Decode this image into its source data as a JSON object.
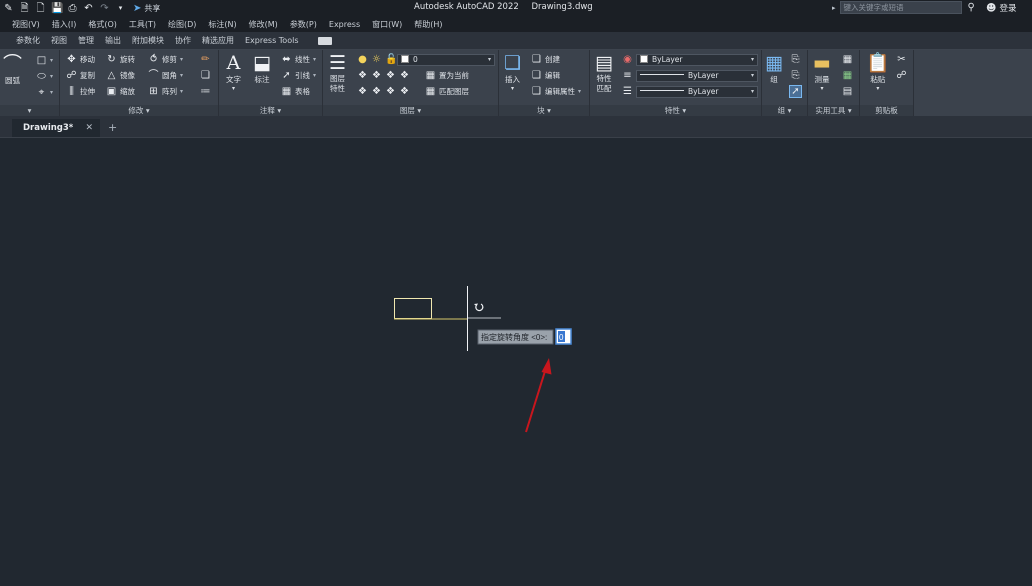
{
  "titlebar": {
    "share_label": "共享",
    "app_title": "Autodesk AutoCAD 2022",
    "doc_title": "Drawing3.dwg",
    "search_placeholder": "键入关键字或短语",
    "login_label": "登录"
  },
  "menu": [
    "视图(V)",
    "插入(I)",
    "格式(O)",
    "工具(T)",
    "绘图(D)",
    "标注(N)",
    "修改(M)",
    "参数(P)",
    "Express",
    "窗口(W)",
    "帮助(H)"
  ],
  "ribbon_tabs": [
    "参数化",
    "视图",
    "管理",
    "输出",
    "附加模块",
    "协作",
    "精选应用",
    "Express Tools"
  ],
  "ribbon": {
    "draw_arc": "圆弧",
    "modify": {
      "title": "修改",
      "move": "移动",
      "rotate": "旋转",
      "trim": "修剪",
      "copy": "复制",
      "mirror": "镜像",
      "fillet": "圆角",
      "stretch": "拉伸",
      "scale": "缩放",
      "array": "阵列"
    },
    "annotation": {
      "title": "注释",
      "text": "文字",
      "dimension": "标注",
      "linear": "线性",
      "leader": "引线",
      "table": "表格"
    },
    "layers": {
      "title": "图层",
      "layer_props": "图层\n特性",
      "current_layer": "0",
      "set_current": "置为当前",
      "match_layer": "匹配图层"
    },
    "block": {
      "title": "块",
      "insert": "插入",
      "create": "创建",
      "edit": "编辑",
      "edit_attr": "编辑属性"
    },
    "properties": {
      "title": "特性",
      "match": "特性\n匹配",
      "color": "ByLayer",
      "linetype": "ByLayer",
      "lineweight": "ByLayer"
    },
    "groups": {
      "title": "组",
      "group": "组"
    },
    "utilities": {
      "title": "实用工具",
      "measure": "测量"
    },
    "clipboard": {
      "title": "剪贴板",
      "paste": "粘贴"
    }
  },
  "doc_tab": {
    "name": "Drawing3*"
  },
  "canvas": {
    "prompt_label": "指定旋转角度 <0>:",
    "prompt_value": "0"
  },
  "colors": {
    "canvas_bg": "#212830",
    "rectangle": "#f0e8b0",
    "crosshair": "#f0f2f5",
    "arrow": "#c8161d"
  }
}
